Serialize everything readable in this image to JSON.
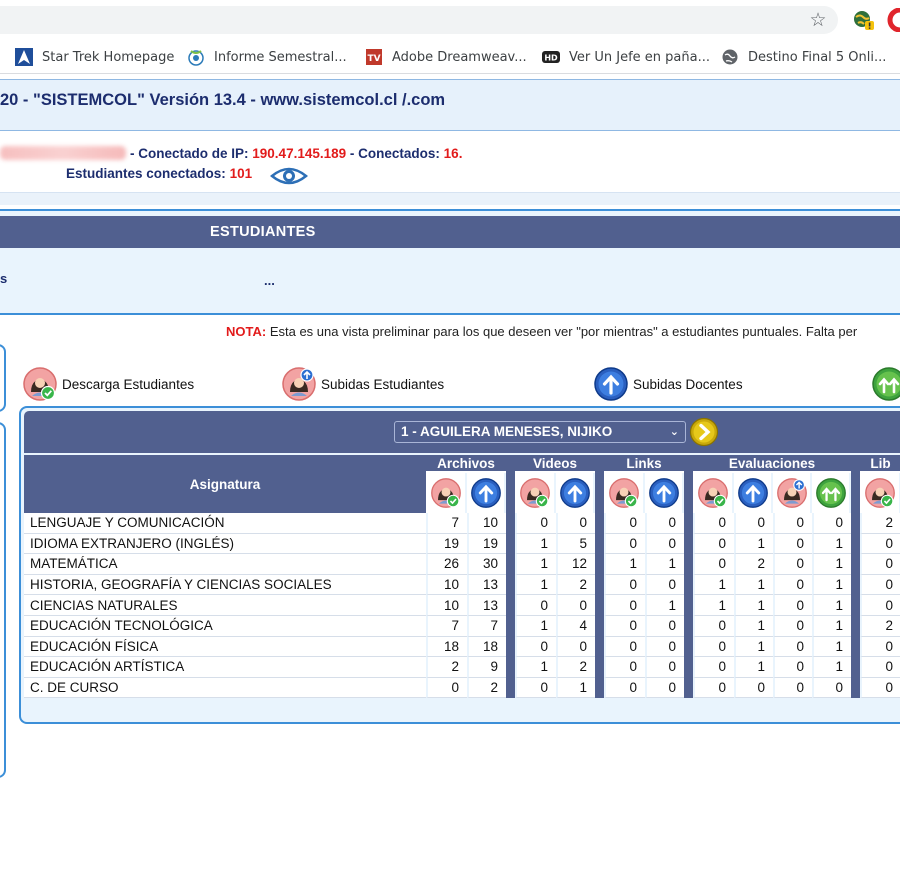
{
  "browser": {
    "bookmarks": [
      {
        "label": "Star Trek Homepage",
        "icon": "star-trek-icon"
      },
      {
        "label": "Informe Semestral...",
        "icon": "globe-icon"
      },
      {
        "label": "Adobe Dreamweav...",
        "icon": "tv-icon"
      },
      {
        "label": "Ver Un Jefe en paña...",
        "icon": "hd-icon"
      },
      {
        "label": "Destino Final 5 Onli...",
        "icon": "globe-icon"
      }
    ]
  },
  "app": {
    "title": "20 - \"SISTEMCOL\" Versión 13.4 - www.sistemcol.cl   /.com",
    "connection": {
      "ip_label": "- Conectado de IP:",
      "ip": "190.47.145.189",
      "connected_label": "- Conectados:",
      "connected": "16.",
      "students_label": "Estudiantes conectados:",
      "students": "101"
    }
  },
  "panel": {
    "title": "ESTUDIANTES",
    "left_text": "s",
    "dots": "..."
  },
  "nota": {
    "label": "NOTA:",
    "text": " Esta es una vista preliminar para los que deseen ver \"por mientras\" a estudiantes puntuales. Falta per"
  },
  "legend": {
    "descarga": "Descarga Estudiantes",
    "subidas_est": "Subidas Estudiantes",
    "subidas_doc": "Subidas Docentes"
  },
  "student_select": {
    "value": "1 - AGUILERA MENESES, NIJIKO"
  },
  "table": {
    "subject_header": "Asignatura",
    "groups": [
      "Archivos",
      "Videos",
      "Links",
      "Evaluaciones",
      "Lib"
    ],
    "rows": [
      {
        "subject": "LENGUAJE Y COMUNICACIÓN",
        "archivos": [
          "7",
          "10"
        ],
        "videos": [
          "0",
          "0"
        ],
        "links": [
          "0",
          "0"
        ],
        "evaluaciones": [
          "0",
          "0",
          "0",
          "0"
        ],
        "lib": "2"
      },
      {
        "subject": "IDIOMA EXTRANJERO (INGLÉS)",
        "archivos": [
          "19",
          "19"
        ],
        "videos": [
          "1",
          "5"
        ],
        "links": [
          "0",
          "0"
        ],
        "evaluaciones": [
          "0",
          "1",
          "0",
          "1"
        ],
        "lib": "0"
      },
      {
        "subject": "MATEMÁTICA",
        "archivos": [
          "26",
          "30"
        ],
        "videos": [
          "1",
          "12"
        ],
        "links": [
          "1",
          "1"
        ],
        "evaluaciones": [
          "0",
          "2",
          "0",
          "1"
        ],
        "lib": "0"
      },
      {
        "subject": "HISTORIA, GEOGRAFÍA Y CIENCIAS SOCIALES",
        "archivos": [
          "10",
          "13"
        ],
        "videos": [
          "1",
          "2"
        ],
        "links": [
          "0",
          "0"
        ],
        "evaluaciones": [
          "1",
          "1",
          "0",
          "1"
        ],
        "lib": "0"
      },
      {
        "subject": "CIENCIAS NATURALES",
        "archivos": [
          "10",
          "13"
        ],
        "videos": [
          "0",
          "0"
        ],
        "links": [
          "0",
          "1"
        ],
        "evaluaciones": [
          "1",
          "1",
          "0",
          "1"
        ],
        "lib": "0"
      },
      {
        "subject": "EDUCACIÓN TECNOLÓGICA",
        "archivos": [
          "7",
          "7"
        ],
        "videos": [
          "1",
          "4"
        ],
        "links": [
          "0",
          "0"
        ],
        "evaluaciones": [
          "0",
          "1",
          "0",
          "1"
        ],
        "lib": "2"
      },
      {
        "subject": "EDUCACIÓN FÍSICA",
        "archivos": [
          "18",
          "18"
        ],
        "videos": [
          "0",
          "0"
        ],
        "links": [
          "0",
          "0"
        ],
        "evaluaciones": [
          "0",
          "1",
          "0",
          "1"
        ],
        "lib": "0"
      },
      {
        "subject": "EDUCACIÓN ARTÍSTICA",
        "archivos": [
          "2",
          "9"
        ],
        "videos": [
          "1",
          "2"
        ],
        "links": [
          "0",
          "0"
        ],
        "evaluaciones": [
          "0",
          "1",
          "0",
          "1"
        ],
        "lib": "0"
      },
      {
        "subject": "C. DE CURSO",
        "archivos": [
          "0",
          "2"
        ],
        "videos": [
          "0",
          "1"
        ],
        "links": [
          "0",
          "0"
        ],
        "evaluaciones": [
          "0",
          "0",
          "0",
          "0"
        ],
        "lib": "0"
      }
    ]
  },
  "colors": {
    "header_bg": "#51608f",
    "accent_blue": "#3c8fd8",
    "alert_red": "#e21b1b",
    "title_navy": "#1c2d6e"
  }
}
